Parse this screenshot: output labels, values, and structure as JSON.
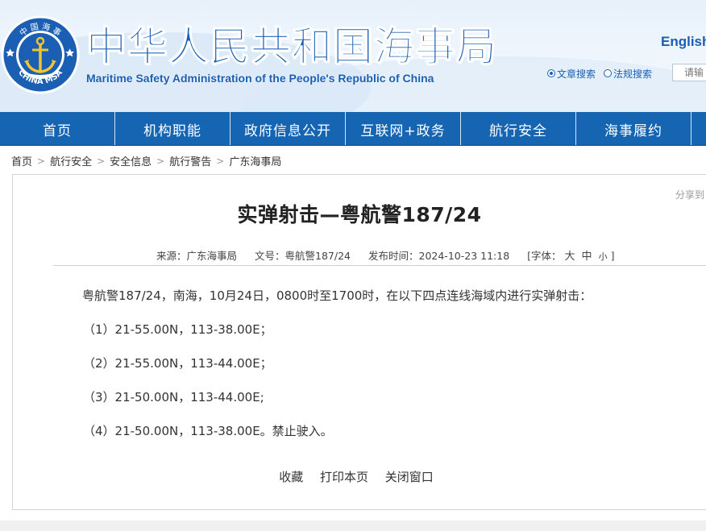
{
  "header": {
    "title": "中华人民共和国海事局",
    "subtitle": "Maritime Safety Administration of the People's Republic of China",
    "emblem_top_text": "中 国 海 事",
    "emblem_bottom_text": "CHINA MSA",
    "lang_link": "English",
    "search": {
      "option_articles": "文章搜索",
      "option_regulations": "法规搜索",
      "placeholder": "请输"
    }
  },
  "nav": {
    "items": [
      {
        "label": "首页"
      },
      {
        "label": "机构职能"
      },
      {
        "label": "政府信息公开"
      },
      {
        "label": "互联网+政务"
      },
      {
        "label": "航行安全"
      },
      {
        "label": "海事履约"
      }
    ]
  },
  "breadcrumb": {
    "items": [
      "首页",
      "航行安全",
      "安全信息",
      "航行警告",
      "广东海事局"
    ],
    "separator": ">"
  },
  "article": {
    "share_label": "分享到",
    "title": "实弹射击—粤航警187/24",
    "source": "来源：广东海事局",
    "doc_no": "文号：粤航警187/24",
    "publish_time": "发布时间：2024-10-23 11:18",
    "font_size_label_open": "[字体：",
    "font_big": "大",
    "font_mid": "中",
    "font_small": "小",
    "font_size_label_close": "]",
    "paragraphs": [
      "粤航警187/24，南海，10月24日，0800时至1700时，在以下四点连线海域内进行实弹射击：",
      "（1）21-55.00N，113-38.00E；",
      "（2）21-55.00N，113-44.00E；",
      "（3）21-50.00N，113-44.00E;",
      "（4）21-50.00N，113-38.00E。禁止驶入。"
    ]
  },
  "actions": {
    "favorite": "收藏",
    "print": "打印本页",
    "close": "关闭窗口"
  },
  "colors": {
    "brand_blue": "#1a5fb4",
    "nav_blue": "#1565b3",
    "emblem_gold": "#f4c430"
  }
}
